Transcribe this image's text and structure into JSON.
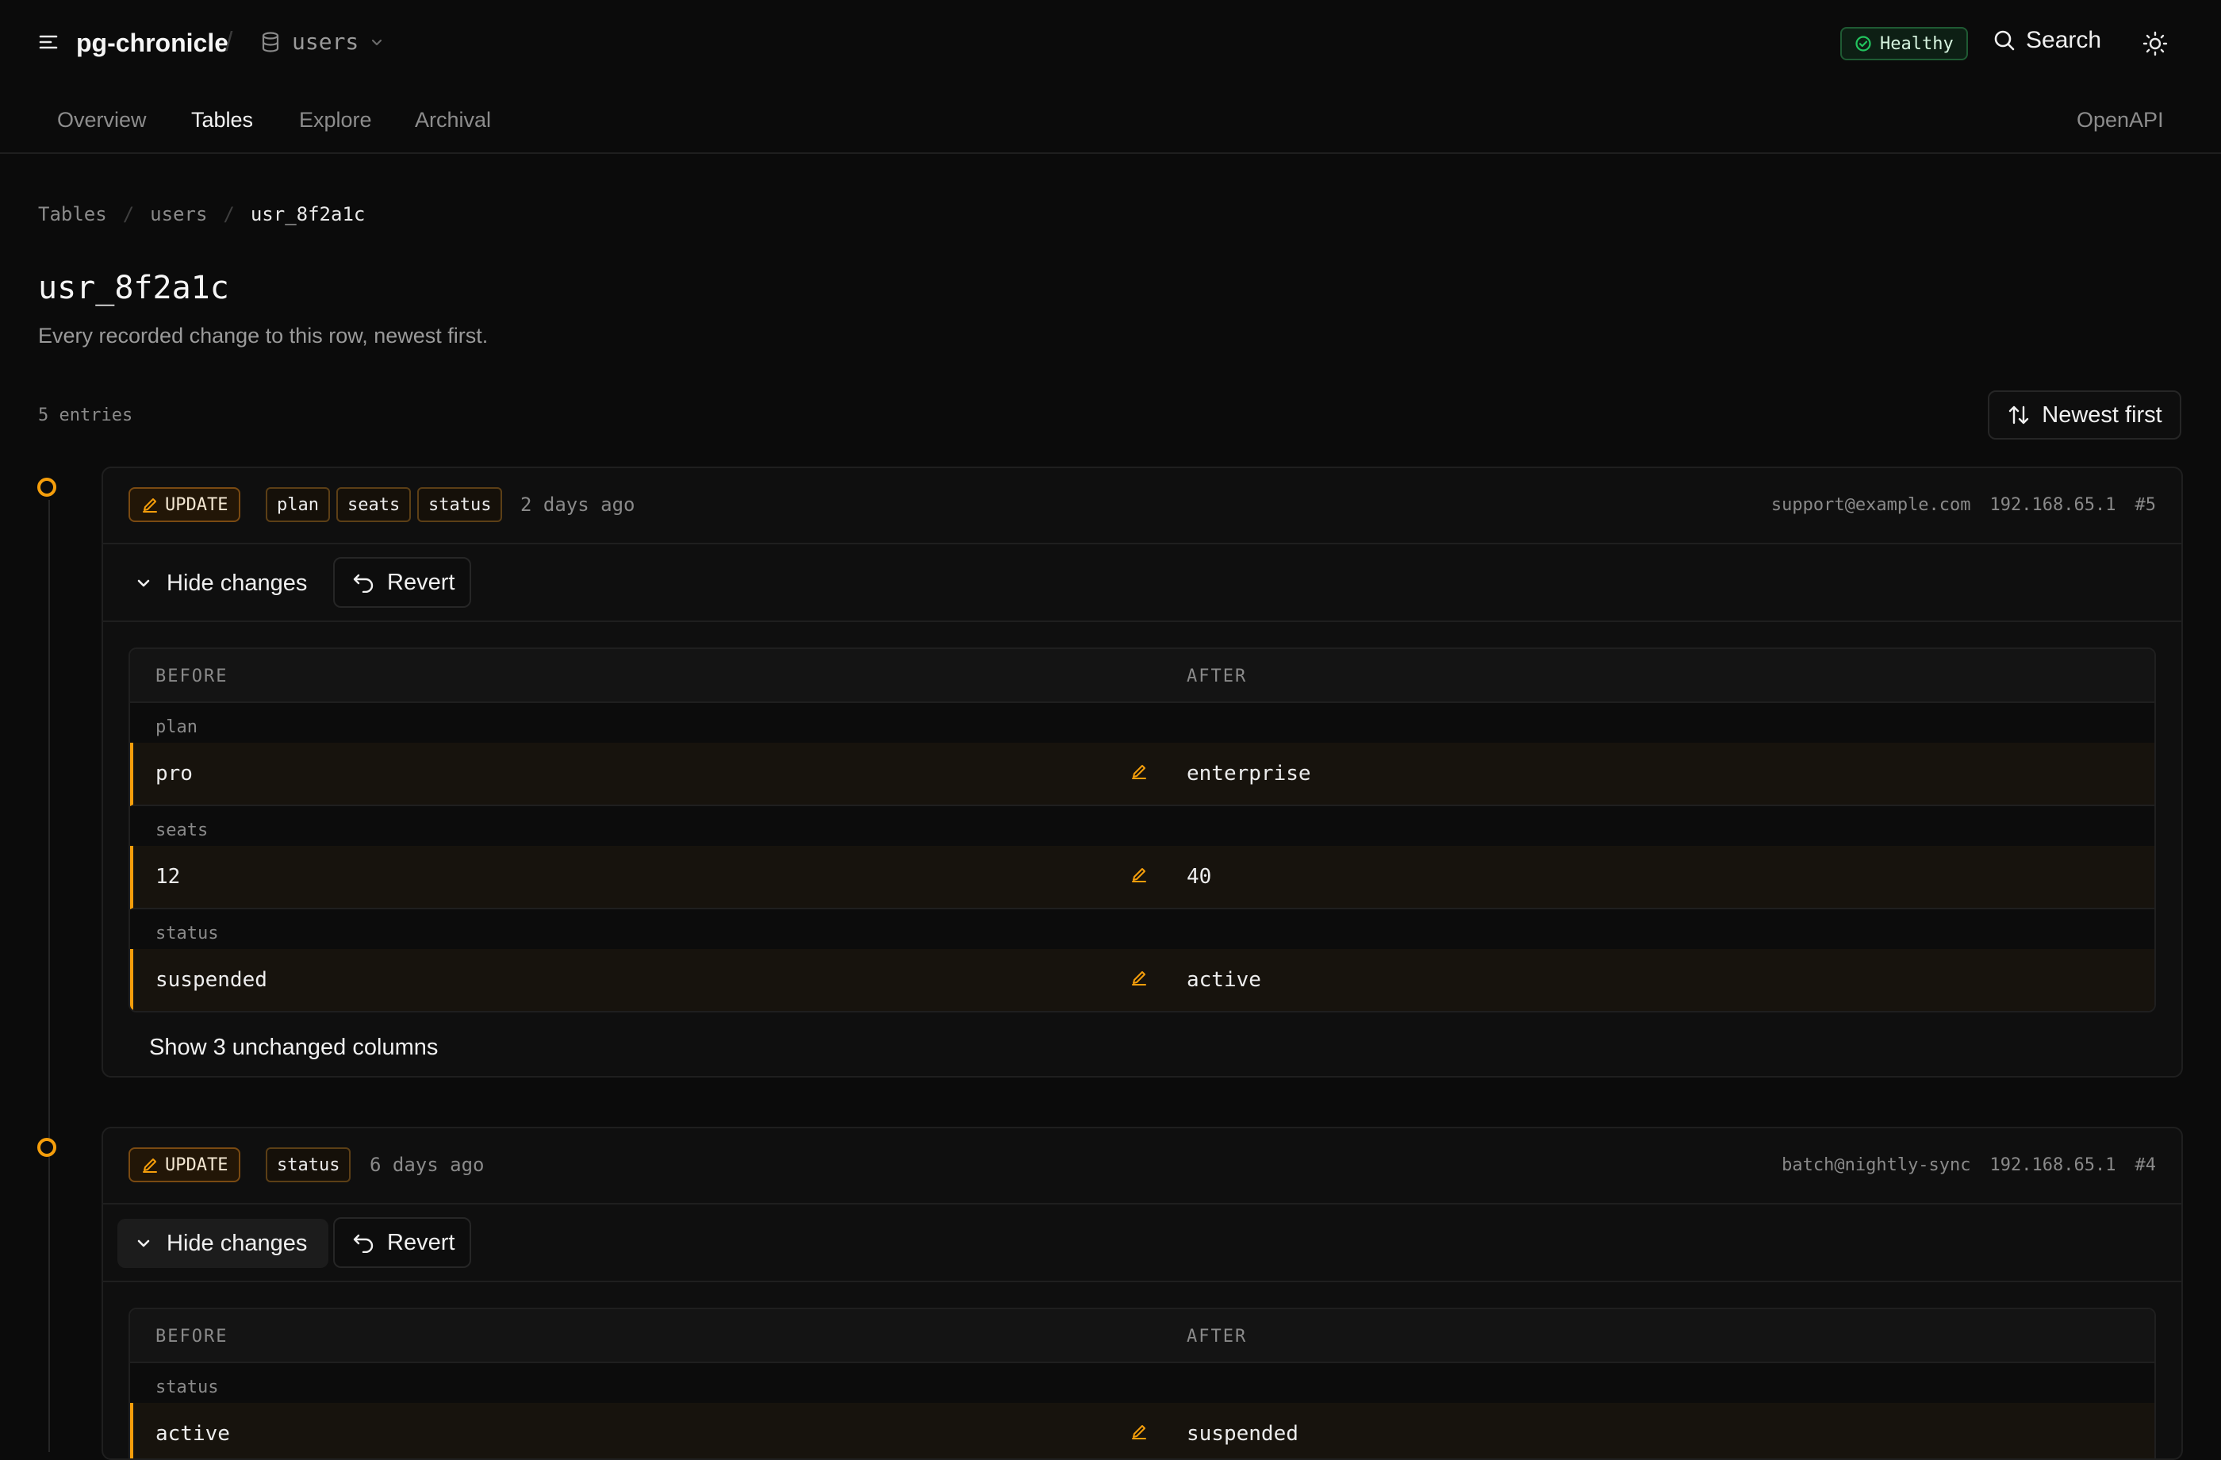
{
  "header": {
    "app_title": "pg-chronicle",
    "title_separator": "/",
    "database": "users",
    "health": "Healthy",
    "search": "Search"
  },
  "nav": {
    "tabs": [
      {
        "label": "Overview",
        "active": false
      },
      {
        "label": "Tables",
        "active": true
      },
      {
        "label": "Explore",
        "active": false
      },
      {
        "label": "Archival",
        "active": false
      }
    ],
    "openapi": "OpenAPI"
  },
  "breadcrumb": [
    "Tables",
    "users",
    "usr_8f2a1c"
  ],
  "breadcrumb_separator": "/",
  "page": {
    "title": "usr_8f2a1c",
    "subtitle": "Every recorded change to this row, newest first.",
    "entries_count": "5 entries",
    "sort_label": "Newest first"
  },
  "labels": {
    "hide_changes": "Hide changes",
    "revert": "Revert",
    "before": "BEFORE",
    "after": "AFTER"
  },
  "entries": [
    {
      "operation": "UPDATE",
      "columns": [
        "plan",
        "seats",
        "status"
      ],
      "time": "2 days ago",
      "user": "support@example.com",
      "ip": "192.168.65.1",
      "id": "#5",
      "changes": [
        {
          "field": "plan",
          "before": "pro",
          "after": "enterprise"
        },
        {
          "field": "seats",
          "before": "12",
          "after": "40"
        },
        {
          "field": "status",
          "before": "suspended",
          "after": "active"
        }
      ],
      "show_unchanged": "Show 3 unchanged columns"
    },
    {
      "operation": "UPDATE",
      "columns": [
        "status"
      ],
      "time": "6 days ago",
      "user": "batch@nightly-sync",
      "ip": "192.168.65.1",
      "id": "#4",
      "changes": [
        {
          "field": "status",
          "before": "active",
          "after": "suspended"
        }
      ]
    }
  ],
  "colors": {
    "accent": "#f59e0b",
    "healthy": "#22c55e",
    "background": "#0b0b0b"
  },
  "icons": [
    "menu-icon",
    "database-icon",
    "chevron-down-icon",
    "check-circle-icon",
    "search-icon",
    "sun-icon",
    "sort-icon",
    "pencil-icon",
    "undo-icon"
  ]
}
